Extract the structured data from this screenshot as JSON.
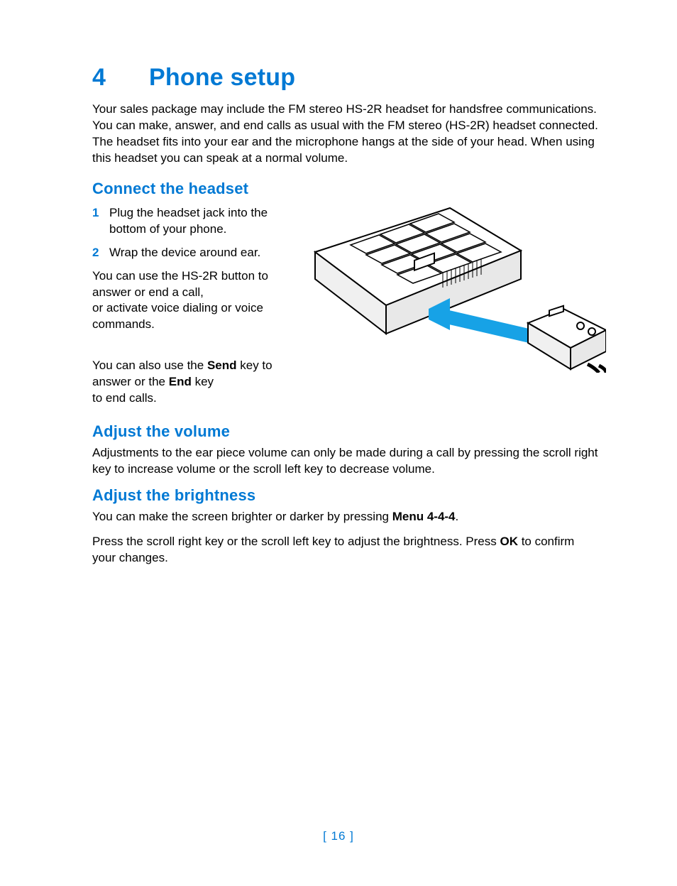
{
  "chapter": {
    "number": "4",
    "title": "Phone setup"
  },
  "intro": "Your sales package may include the FM stereo HS-2R headset for handsfree communications. You can make, answer, and end calls as usual with the FM stereo (HS-2R) headset connected. The headset fits into your ear and the microphone hangs at the side of your head. When using this headset you can speak at a normal volume.",
  "sections": {
    "connect": {
      "heading": "Connect the headset",
      "steps": [
        {
          "n": "1",
          "text": "Plug the headset jack into the bottom of your phone."
        },
        {
          "n": "2",
          "text": "Wrap the device around ear."
        }
      ],
      "para1": "You can use the HS-2R button to answer or end a call,\nor activate voice dialing or voice commands.",
      "para2_a": "You can also use the ",
      "para2_b": "Send",
      "para2_c": " key to answer or the ",
      "para2_d": "End",
      "para2_e": " key\nto end calls."
    },
    "volume": {
      "heading": "Adjust the volume",
      "para": "Adjustments to the ear piece volume can only be made during a call by pressing the scroll right key to increase volume or the scroll left key to decrease volume."
    },
    "brightness": {
      "heading": "Adjust the brightness",
      "para1_a": "You can make the screen brighter or darker by pressing ",
      "para1_b": "Menu 4-4-4",
      "para1_c": ".",
      "para2_a": "Press the scroll right key or the scroll left key to adjust the brightness. Press ",
      "para2_b": "OK",
      "para2_c": " to confirm your changes."
    }
  },
  "page_number": "[ 16 ]",
  "illustration_name": "phone-headset-connection-diagram"
}
